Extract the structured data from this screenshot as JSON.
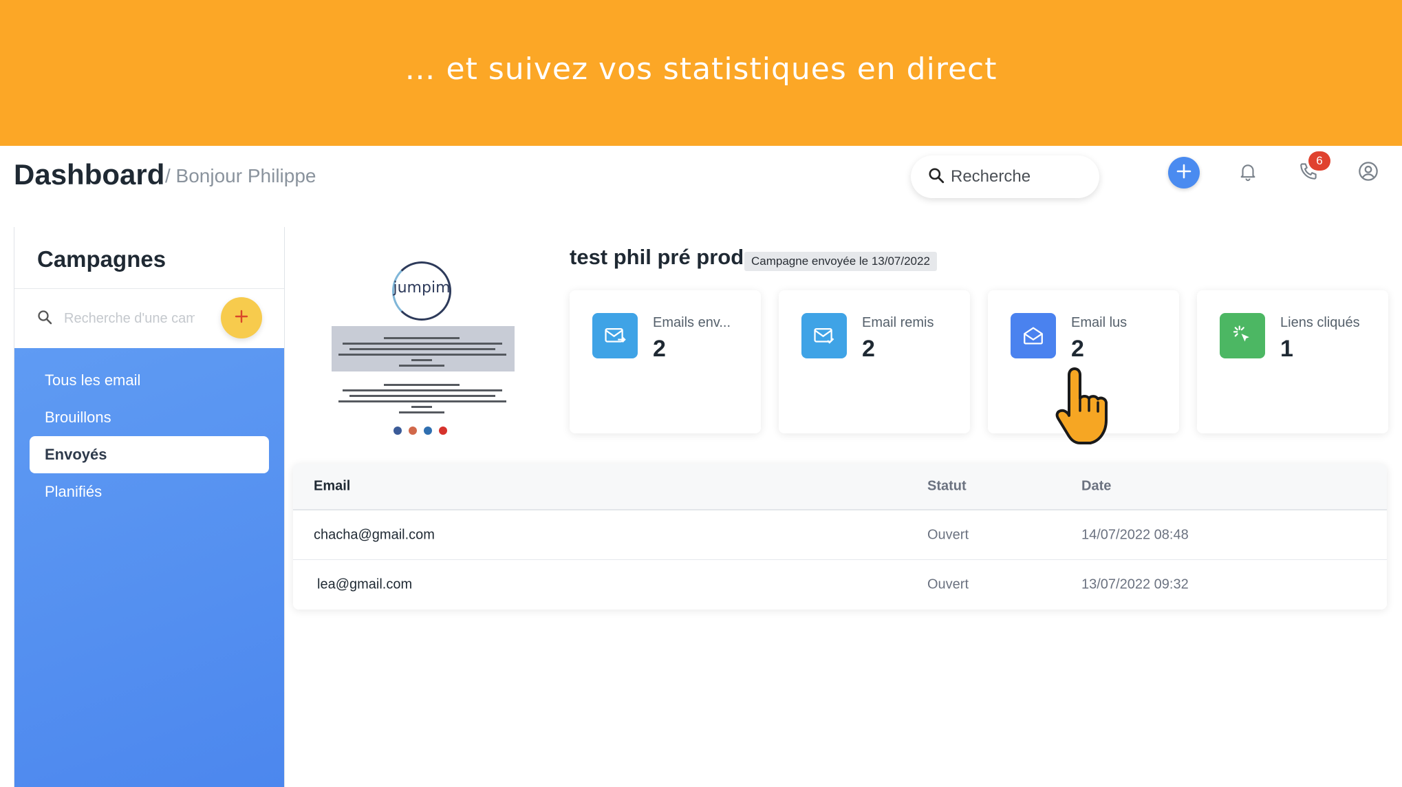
{
  "banner": {
    "text": "… et suivez vos statistiques en direct"
  },
  "header": {
    "title": "Dashboard",
    "subtitle": "/ Bonjour Philippe",
    "search_placeholder": "Recherche",
    "notification_badge": "6"
  },
  "sidebar": {
    "title": "Campagnes",
    "search_placeholder": "Recherche d'une campagne",
    "items": [
      {
        "label": "Tous les email",
        "active": false
      },
      {
        "label": "Brouillons",
        "active": false
      },
      {
        "label": "Envoyés",
        "active": true
      },
      {
        "label": "Planifiés",
        "active": false
      }
    ]
  },
  "preview": {
    "logo_text": "jumpim"
  },
  "campaign": {
    "title": "test phil pré prod",
    "tag": "Campagne envoyée le 13/07/2022"
  },
  "stats": [
    {
      "label": "Emails env...",
      "value": "2",
      "color": "#3FA3E6",
      "icon": "mail-send-icon"
    },
    {
      "label": "Email remis",
      "value": "2",
      "color": "#3FA3E6",
      "icon": "mail-check-icon"
    },
    {
      "label": "Email lus",
      "value": "2",
      "color": "#4A82EF",
      "icon": "mail-open-icon"
    },
    {
      "label": "Liens cliqués",
      "value": "1",
      "color": "#4CB763",
      "icon": "click-icon"
    }
  ],
  "table": {
    "headers": [
      "Email",
      "Statut",
      "Date"
    ],
    "rows": [
      [
        "chacha@gmail.com",
        "Ouvert",
        "14/07/2022 08:48"
      ],
      [
        "lea@gmail.com",
        "Ouvert",
        "13/07/2022 09:32"
      ]
    ]
  },
  "colors": {
    "banner": "#FCA726",
    "primary": "#4A8BF0",
    "add_button": "#F7CB4D",
    "badge": "#E0422F"
  }
}
